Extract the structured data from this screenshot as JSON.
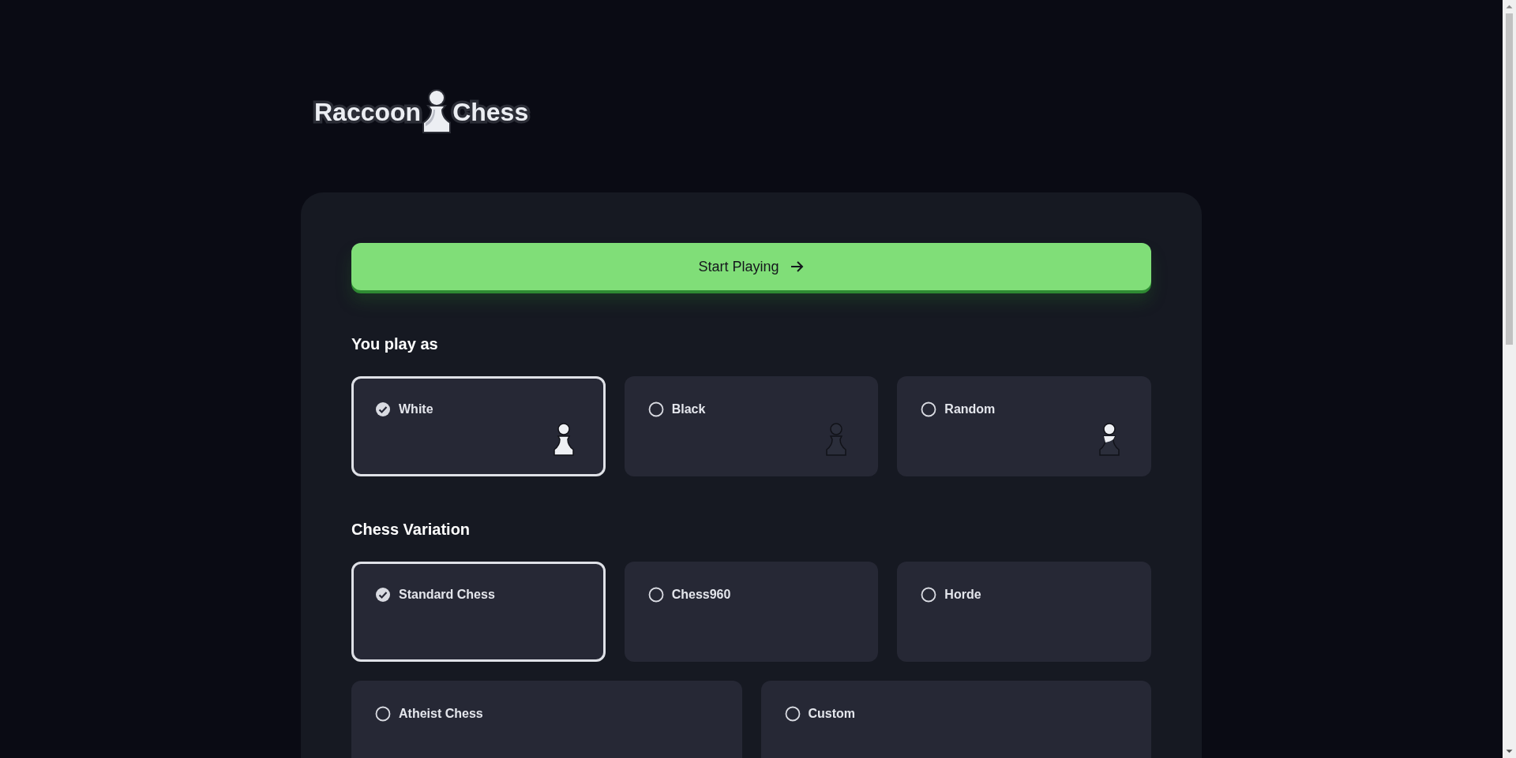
{
  "logo": {
    "left": "Raccoon",
    "right": "Chess"
  },
  "start_button": {
    "label": "Start Playing"
  },
  "sections": [
    {
      "title": "You play as",
      "kind": "three",
      "options": [
        {
          "label": "White",
          "selected": true,
          "kind": "white"
        },
        {
          "label": "Black",
          "selected": false,
          "kind": "black"
        },
        {
          "label": "Random",
          "selected": false,
          "kind": "random"
        }
      ]
    },
    {
      "title": "Chess Variation",
      "kind": "mixed",
      "options": [
        {
          "label": "Standard Chess",
          "selected": true
        },
        {
          "label": "Chess960",
          "selected": false
        },
        {
          "label": "Horde",
          "selected": false
        },
        {
          "label": "Atheist Chess",
          "selected": false
        },
        {
          "label": "Custom",
          "selected": false
        }
      ]
    }
  ]
}
